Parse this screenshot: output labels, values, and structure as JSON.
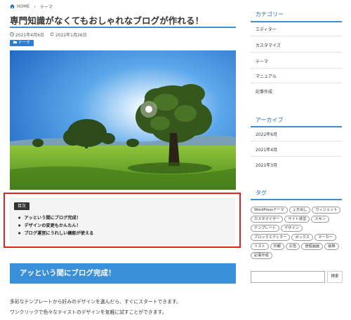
{
  "breadcrumb": {
    "home": "HOME",
    "current": "テーマ"
  },
  "article": {
    "title": "専門知識がなくてもおしゃれなブログが作れる！",
    "published": "2021年4月6日",
    "updated": "2022年1月26日",
    "category_badge": "テーマ"
  },
  "toc": {
    "label": "目次",
    "items": [
      "アッという間にブログ完成！",
      "デザインの変更もかんたん！",
      "ブログ運営にうれしい機能が使える"
    ]
  },
  "section": {
    "heading": "アッという間にブログ完成！",
    "lines": [
      "多彩なテンプレートから好みのデザインを選んだら、すぐにスタートできます。",
      "ワンクリックで色々なテイストのデザインを気軽に試すことができます。"
    ]
  },
  "sidebar": {
    "categories": {
      "title": "カテゴリー",
      "items": [
        "エディター",
        "カスタマイズ",
        "テーマ",
        "マニュアル",
        "記事作成"
      ]
    },
    "archive": {
      "title": "アーカイブ",
      "items": [
        "2022年6月",
        "2021年4月",
        "2021年3月"
      ]
    },
    "tags": {
      "title": "タグ",
      "items": [
        "WordPressテーマ",
        "ふき出し",
        "ウィジェット",
        "カスタマイザー",
        "サイト運営",
        "スキン",
        "テンプレート",
        "デザイン",
        "ブロックエディター",
        "ボックス",
        "マーカー",
        "リスト",
        "外観",
        "広告",
        "管理画面",
        "装飾",
        "記事作成"
      ]
    },
    "search": {
      "value": "",
      "button": "検索"
    }
  },
  "colors": {
    "accent": "#3a8fd9",
    "highlight_frame": "#e2241f",
    "link": "#2a6db8"
  },
  "icons": {
    "home": "home-icon",
    "published": "clock-icon",
    "updated": "refresh-icon",
    "category": "folder-icon"
  }
}
